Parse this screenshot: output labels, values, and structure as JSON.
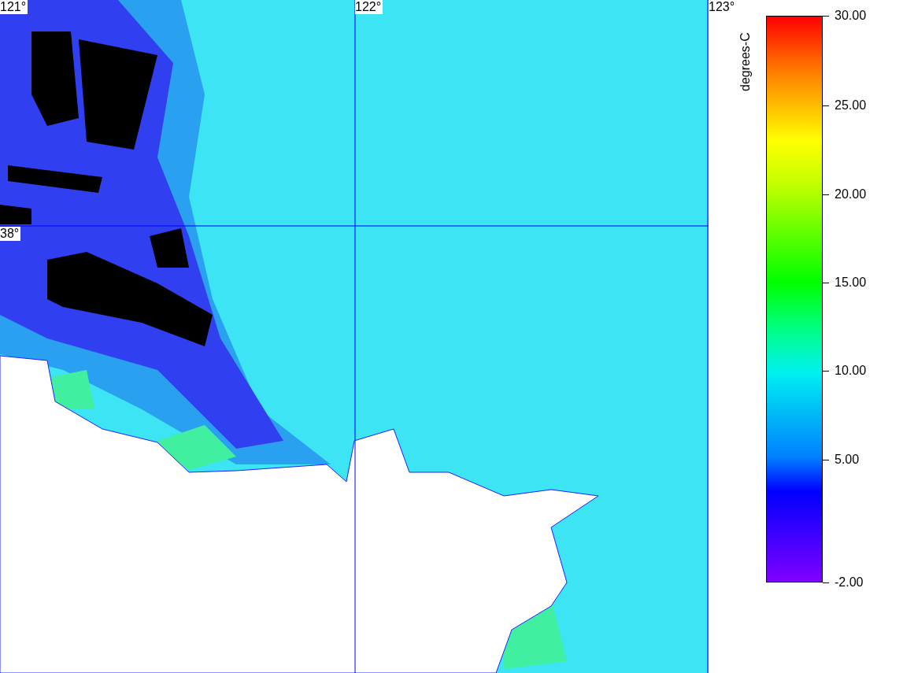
{
  "map": {
    "longitude_labels": [
      "121°",
      "122°",
      "123°"
    ],
    "latitude_labels": [
      "38°"
    ]
  },
  "legend": {
    "title": "degrees-C",
    "ticks": [
      "30.00",
      "25.00",
      "20.00",
      "15.00",
      "10.00",
      "5.00",
      "-2.00"
    ]
  }
}
